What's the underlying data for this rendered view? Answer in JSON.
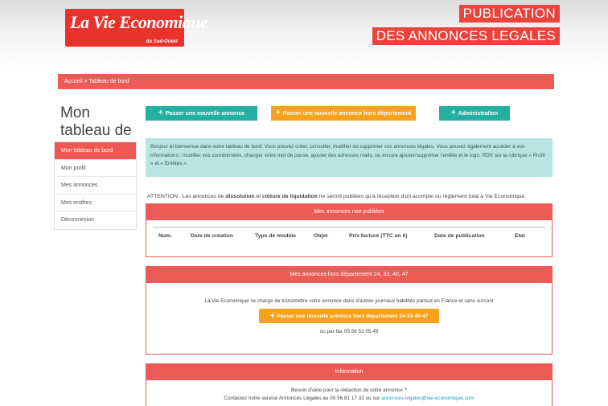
{
  "header": {
    "logo_main": "La Vie Economique",
    "logo_sub": "du Sud-Ouest",
    "publication_line1": "PUBLICATION",
    "publication_line2": "DES ANNONCES LEGALES"
  },
  "breadcrumb": "Accueil > Tableau de bord",
  "page_title": "Mon tableau de bord",
  "actions": {
    "new_ad": "Passer une nouvelle annonce",
    "new_ad_out": "Passer une nouvelle annonce hors département",
    "admin": "Administration"
  },
  "sidebar": {
    "items": [
      {
        "label": "Mon tableau de bord"
      },
      {
        "label": "Mon profil"
      },
      {
        "label": "Mes annonces"
      },
      {
        "label": "Mes entêtes"
      },
      {
        "label": "Déconnexion"
      }
    ]
  },
  "welcome_text": "Bonjour et bienvenue dans votre tableau de bord. Vous pouvez créer, consulter, modifier ou supprimer vos annonces légales. Vous pouvez également accéder à vos informations : modifier vos coordonnées, changer votre mot de passe, ajouter des adresses mails, ou encore ajouter/supprimer l'entête et le logo. RDV sur la rubrique « Profil » et « Entêtes ».",
  "attention": {
    "prefix": "ATTENTION : Les annonces de ",
    "word1": "dissolution",
    "mid": " et ",
    "word2": "clôture de liquidation",
    "suffix": " ne seront publiées qu'à réception d'un acompte ou règlement total à Vie Economique."
  },
  "unpublished": {
    "title": "Mes annonces non publiées",
    "columns": [
      "Num.",
      "Date de création",
      "Type de modèle",
      "Objet",
      "Prix facturé (TTC en €)",
      "Date de publication",
      "Etat"
    ]
  },
  "out_of_dept": {
    "title": "Mes annonces hors département 24, 33, 40, 47",
    "line": "La Vie Economique se charge de transmettre votre annonce dans d'autres journaux habilités partout en France et sans surcoût",
    "button": "Passer une nouvelle annonce hors département 24-33-40-47",
    "fax": "ou par fax 05 56 52 05 49"
  },
  "info": {
    "title": "Information",
    "line1": "Besoin d'aide pour la rédaction de votre annonce ?",
    "line2_prefix": "Contactez notre service Annonces Légales au 05 56 81 17 32 ou sur ",
    "email": "annonces-legales@vie-economique.com"
  }
}
